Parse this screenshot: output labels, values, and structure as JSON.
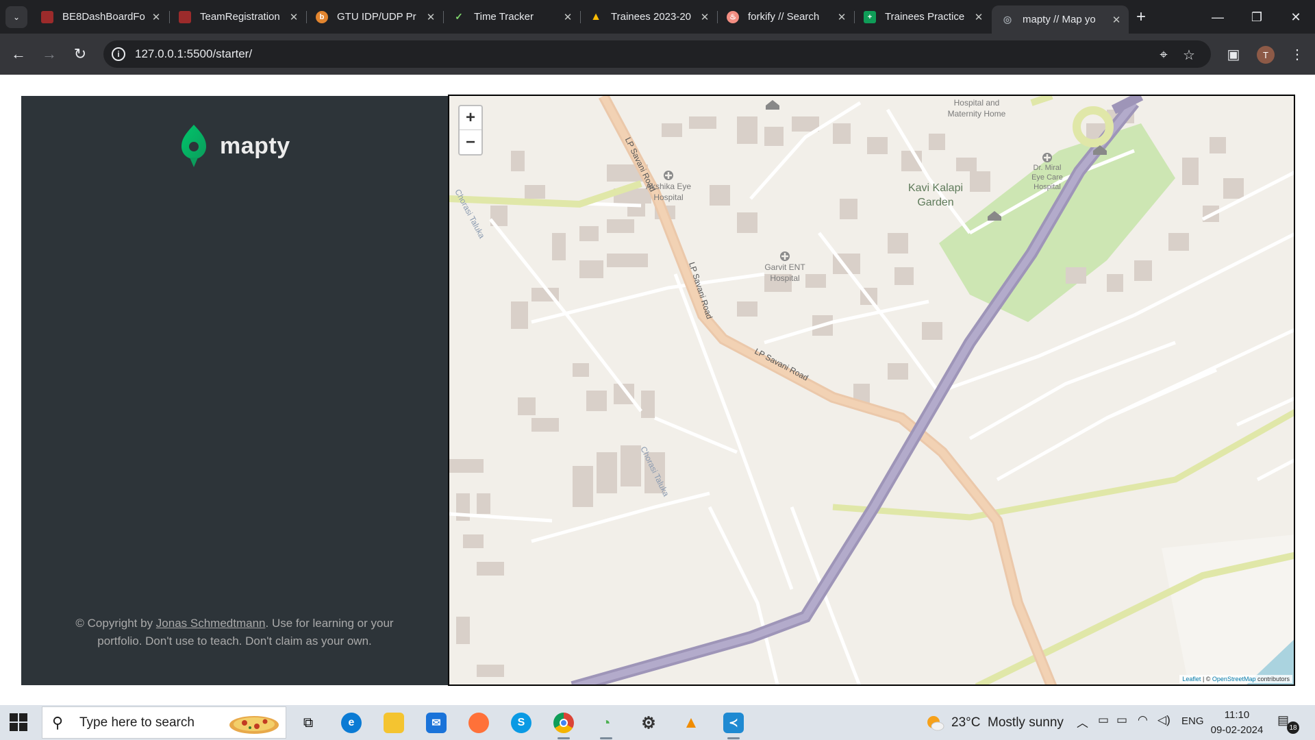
{
  "browser": {
    "tabs": [
      {
        "title": "BE8DashBoardFo",
        "favicon": "#9c2b2b",
        "favicon_text": ""
      },
      {
        "title": "TeamRegistration",
        "favicon": "#9c2b2b",
        "favicon_text": ""
      },
      {
        "title": "GTU IDP/UDP Pr",
        "favicon": "#e2852f",
        "favicon_text": "b"
      },
      {
        "title": "Time Tracker",
        "favicon": "#202124",
        "favicon_text": "✓"
      },
      {
        "title": "Trainees 2023-20",
        "favicon": "#1e8e3e",
        "favicon_text": "▲"
      },
      {
        "title": "forkify // Search",
        "favicon": "#f38e82",
        "favicon_text": "♨"
      },
      {
        "title": "Trainees Practice",
        "favicon": "#0f9d58",
        "favicon_text": "+"
      },
      {
        "title": "mapty // Map yo",
        "favicon": "#5f6368",
        "favicon_text": "◎"
      }
    ],
    "active_tab_index": 7,
    "url": "127.0.0.1:5500/starter/",
    "profile_initial": "T"
  },
  "sidebar": {
    "logo_text": "mapty",
    "copyright_prefix": "© Copyright by ",
    "copyright_link": "Jonas Schmedtmann",
    "copyright_suffix": ". Use for learning or your portfolio. Don't use to teach. Don't claim as your own."
  },
  "map": {
    "zoom_in": "+",
    "zoom_out": "−",
    "attribution_leaflet": "Leaflet",
    "attribution_sep": " | © ",
    "attribution_osm": "OpenStreetMap",
    "attribution_suffix": " contributors",
    "labels": {
      "hospital_maternity": "Hospital and Maternity Home",
      "akshika": "Akshika Eye Hospital",
      "garvit": "Garvit ENT Hospital",
      "miral": "Dr. Miral Eye Care Hospital",
      "garden": "Kavi Kalapi Garden",
      "road1": "LP Savani Road",
      "road2": "LP Savani Road",
      "road3": "LP Savani Road",
      "taluka1": "Chorasi Taluka",
      "taluka2": "Chorasi Taluka"
    }
  },
  "taskbar": {
    "search_placeholder": "Type here to search",
    "weather_temp": "23°C",
    "weather_text": "Mostly sunny",
    "language": "ENG",
    "time": "11:10",
    "date": "09-02-2024",
    "notification_count": "18"
  }
}
